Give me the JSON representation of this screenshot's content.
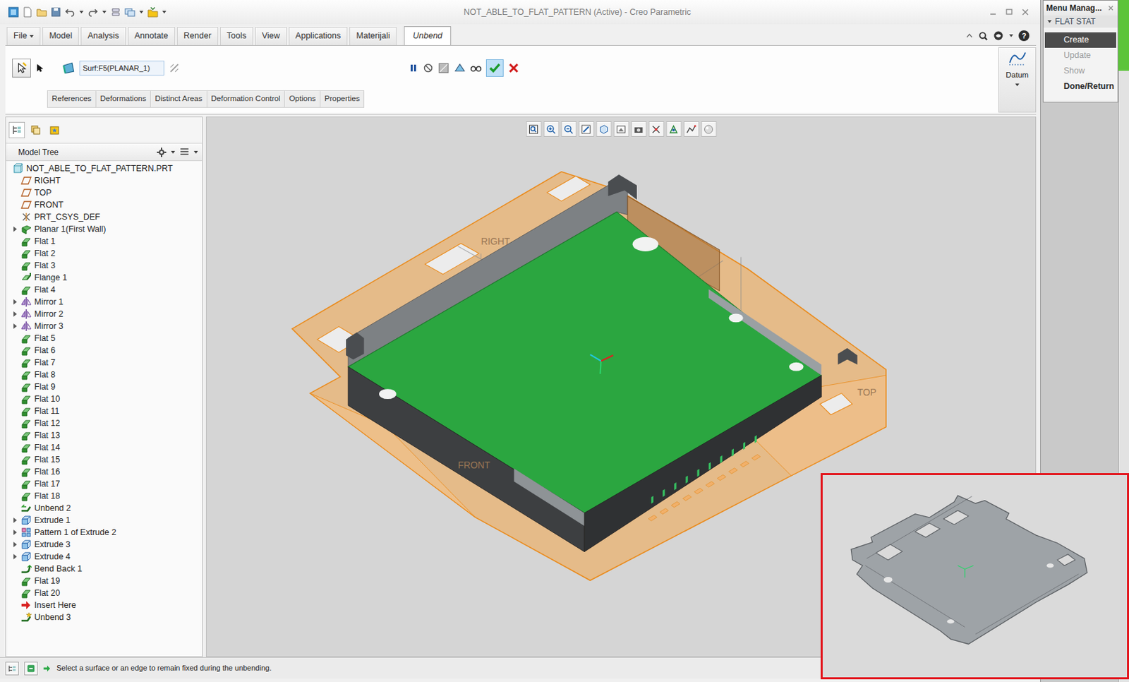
{
  "window": {
    "title": "NOT_ABLE_TO_FLAT_PATTERN (Active) - Creo Parametric"
  },
  "ribbon": {
    "tabs": [
      {
        "label": "File",
        "kind": "menu",
        "selected": false
      },
      {
        "label": "Model",
        "kind": "tab",
        "selected": false
      },
      {
        "label": "Analysis",
        "kind": "tab",
        "selected": false
      },
      {
        "label": "Annotate",
        "kind": "tab",
        "selected": false
      },
      {
        "label": "Render",
        "kind": "tab",
        "selected": false
      },
      {
        "label": "Tools",
        "kind": "tab",
        "selected": false
      },
      {
        "label": "View",
        "kind": "tab",
        "selected": false
      },
      {
        "label": "Applications",
        "kind": "tab",
        "selected": false
      },
      {
        "label": "Materijali",
        "kind": "tab",
        "selected": false
      },
      {
        "label": "Unbend",
        "kind": "tab",
        "selected": true
      }
    ],
    "help": "?",
    "reference_field": "Surf:F5(PLANAR_1)",
    "subtabs": [
      "References",
      "Deformations",
      "Distinct Areas",
      "Deformation Control",
      "Options",
      "Properties"
    ],
    "datum_group": "Datum"
  },
  "model_tree": {
    "title": "Model Tree",
    "items": [
      {
        "label": "NOT_ABLE_TO_FLAT_PATTERN.PRT",
        "kind": "part",
        "depth": 0,
        "expandable": false
      },
      {
        "label": "RIGHT",
        "kind": "datum-plane",
        "depth": 1,
        "expandable": false
      },
      {
        "label": "TOP",
        "kind": "datum-plane",
        "depth": 1,
        "expandable": false
      },
      {
        "label": "FRONT",
        "kind": "datum-plane",
        "depth": 1,
        "expandable": false
      },
      {
        "label": "PRT_CSYS_DEF",
        "kind": "csys",
        "depth": 1,
        "expandable": false
      },
      {
        "label": "Planar 1(First Wall)",
        "kind": "wall",
        "depth": 1,
        "expandable": true
      },
      {
        "label": "Flat 1",
        "kind": "flat",
        "depth": 1,
        "expandable": false
      },
      {
        "label": "Flat 2",
        "kind": "flat",
        "depth": 1,
        "expandable": false
      },
      {
        "label": "Flat 3",
        "kind": "flat",
        "depth": 1,
        "expandable": false
      },
      {
        "label": "Flange 1",
        "kind": "flange",
        "depth": 1,
        "expandable": false
      },
      {
        "label": "Flat 4",
        "kind": "flat",
        "depth": 1,
        "expandable": false
      },
      {
        "label": "Mirror 1",
        "kind": "mirror",
        "depth": 1,
        "expandable": true
      },
      {
        "label": "Mirror 2",
        "kind": "mirror",
        "depth": 1,
        "expandable": true
      },
      {
        "label": "Mirror 3",
        "kind": "mirror",
        "depth": 1,
        "expandable": true
      },
      {
        "label": "Flat 5",
        "kind": "flat",
        "depth": 1,
        "expandable": false
      },
      {
        "label": "Flat 6",
        "kind": "flat",
        "depth": 1,
        "expandable": false
      },
      {
        "label": "Flat 7",
        "kind": "flat",
        "depth": 1,
        "expandable": false
      },
      {
        "label": "Flat 8",
        "kind": "flat",
        "depth": 1,
        "expandable": false
      },
      {
        "label": "Flat 9",
        "kind": "flat",
        "depth": 1,
        "expandable": false
      },
      {
        "label": "Flat 10",
        "kind": "flat",
        "depth": 1,
        "expandable": false
      },
      {
        "label": "Flat 11",
        "kind": "flat",
        "depth": 1,
        "expandable": false
      },
      {
        "label": "Flat 12",
        "kind": "flat",
        "depth": 1,
        "expandable": false
      },
      {
        "label": "Flat 13",
        "kind": "flat",
        "depth": 1,
        "expandable": false
      },
      {
        "label": "Flat 14",
        "kind": "flat",
        "depth": 1,
        "expandable": false
      },
      {
        "label": "Flat 15",
        "kind": "flat",
        "depth": 1,
        "expandable": false
      },
      {
        "label": "Flat 16",
        "kind": "flat",
        "depth": 1,
        "expandable": false
      },
      {
        "label": "Flat 17",
        "kind": "flat",
        "depth": 1,
        "expandable": false
      },
      {
        "label": "Flat 18",
        "kind": "flat",
        "depth": 1,
        "expandable": false
      },
      {
        "label": "Unbend 2",
        "kind": "unbend",
        "depth": 1,
        "expandable": false
      },
      {
        "label": "Extrude 1",
        "kind": "extrude",
        "depth": 1,
        "expandable": true
      },
      {
        "label": "Pattern 1 of Extrude 2",
        "kind": "pattern",
        "depth": 1,
        "expandable": true
      },
      {
        "label": "Extrude 3",
        "kind": "extrude",
        "depth": 1,
        "expandable": true
      },
      {
        "label": "Extrude 4",
        "kind": "extrude",
        "depth": 1,
        "expandable": true
      },
      {
        "label": "Bend Back 1",
        "kind": "bend-back",
        "depth": 1,
        "expandable": false
      },
      {
        "label": "Flat 19",
        "kind": "flat",
        "depth": 1,
        "expandable": false
      },
      {
        "label": "Flat 20",
        "kind": "flat",
        "depth": 1,
        "expandable": false
      },
      {
        "label": "Insert Here",
        "kind": "insert-here",
        "depth": 1,
        "expandable": false
      },
      {
        "label": "Unbend 3",
        "kind": "unbend-new",
        "depth": 1,
        "expandable": false
      }
    ]
  },
  "viewport": {
    "plane_labels": [
      "RIGHT",
      "FRONT",
      "TOP"
    ]
  },
  "menu_manager": {
    "title": "Menu Manag...",
    "section": {
      "label": "FLAT STAT",
      "expanded": true
    },
    "items": [
      {
        "label": "Create",
        "selected": true,
        "disabled": false
      },
      {
        "label": "Update",
        "selected": false,
        "disabled": true
      },
      {
        "label": "Show",
        "selected": false,
        "disabled": true
      },
      {
        "label": "Done/Return",
        "selected": false,
        "disabled": false
      }
    ]
  },
  "status_bar": {
    "message": "Select a surface or an edge to remain fixed during the unbending."
  }
}
